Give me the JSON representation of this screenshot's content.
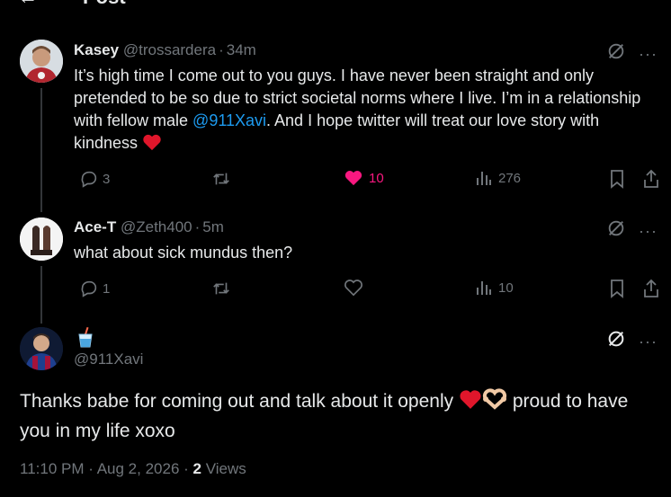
{
  "header": {
    "title": "Post",
    "back_icon": "arrow-left-icon"
  },
  "tweets": [
    {
      "name": "Kasey",
      "handle": "@trossardera",
      "time": "34m",
      "text_before": "It’s high time I come out to you guys. I have never been straight and only pretended to be so due to strict societal norms where I live. I’m in a relationship with fellow male ",
      "mention": "@911Xavi",
      "text_after": ". And I hope twitter will treat our love story with kindness",
      "replies": "3",
      "retweets": "",
      "likes": "10",
      "views": "276",
      "liked": true
    },
    {
      "name": "Ace-T",
      "handle": "@Zeth400",
      "time": "5m",
      "text": "what about sick mundus then?",
      "replies": "1",
      "retweets": "",
      "likes": "",
      "views": "10",
      "liked": false
    }
  ],
  "main_post": {
    "name_emoji": "🥤",
    "handle": "@911Xavi",
    "text_before": "Thanks babe for coming out and talk about it openly ",
    "text_after": " proud to have you in my life xoxo",
    "time": "11:10 PM",
    "date": "Aug 2, 2026",
    "views_count": "2",
    "views_label": "Views"
  },
  "colors": {
    "accent": "#1d9bf0",
    "like": "#f91880",
    "muted": "#71767b",
    "text": "#e7e9ea",
    "heart": "#e0162b"
  }
}
